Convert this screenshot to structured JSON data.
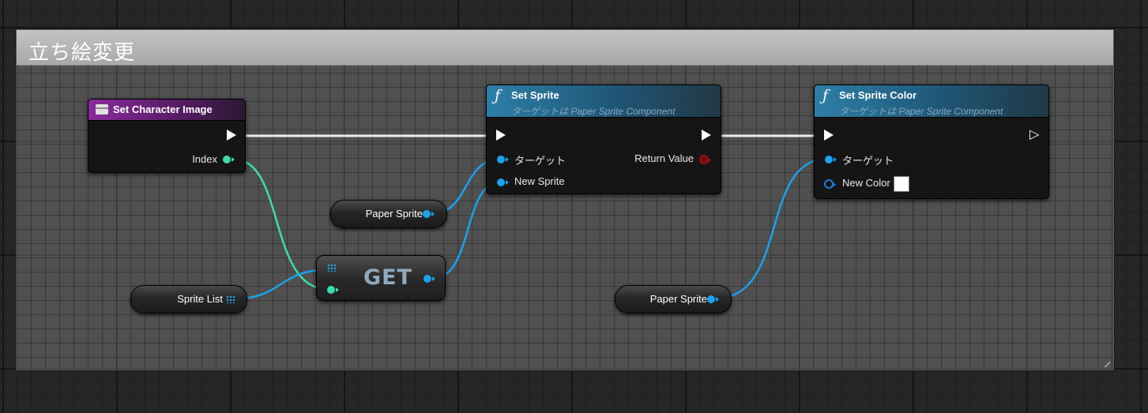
{
  "comment": {
    "title": "立ち絵変更"
  },
  "nodes": {
    "set_character_image": {
      "title": "Set Character Image",
      "icon": "variable-icon",
      "header_color": "#8a2b9c",
      "pins": {
        "index": "Index"
      }
    },
    "set_sprite": {
      "title": "Set Sprite",
      "subtitle": "ターゲットは Paper Sprite Component",
      "icon": "function-icon",
      "header_color": "#2d7fa8",
      "pins": {
        "target": "ターゲット",
        "new_sprite": "New Sprite",
        "return_value": "Return Value"
      }
    },
    "set_sprite_color": {
      "title": "Set Sprite Color",
      "subtitle": "ターゲットは Paper Sprite Component",
      "icon": "function-icon",
      "header_color": "#2d7fa8",
      "pins": {
        "target": "ターゲット",
        "new_color": "New Color"
      },
      "new_color_value": "#ffffff"
    },
    "paper_sprite_1": {
      "label": "Paper Sprite"
    },
    "paper_sprite_2": {
      "label": "Paper Sprite"
    },
    "sprite_list": {
      "label": "Sprite List"
    },
    "get": {
      "label": "GET"
    }
  },
  "colors": {
    "exec_wire": "#ffffff",
    "int_wire": "#3ddcb0",
    "object_wire": "#1aa2ef",
    "comment_header": "#b5b5b5"
  }
}
